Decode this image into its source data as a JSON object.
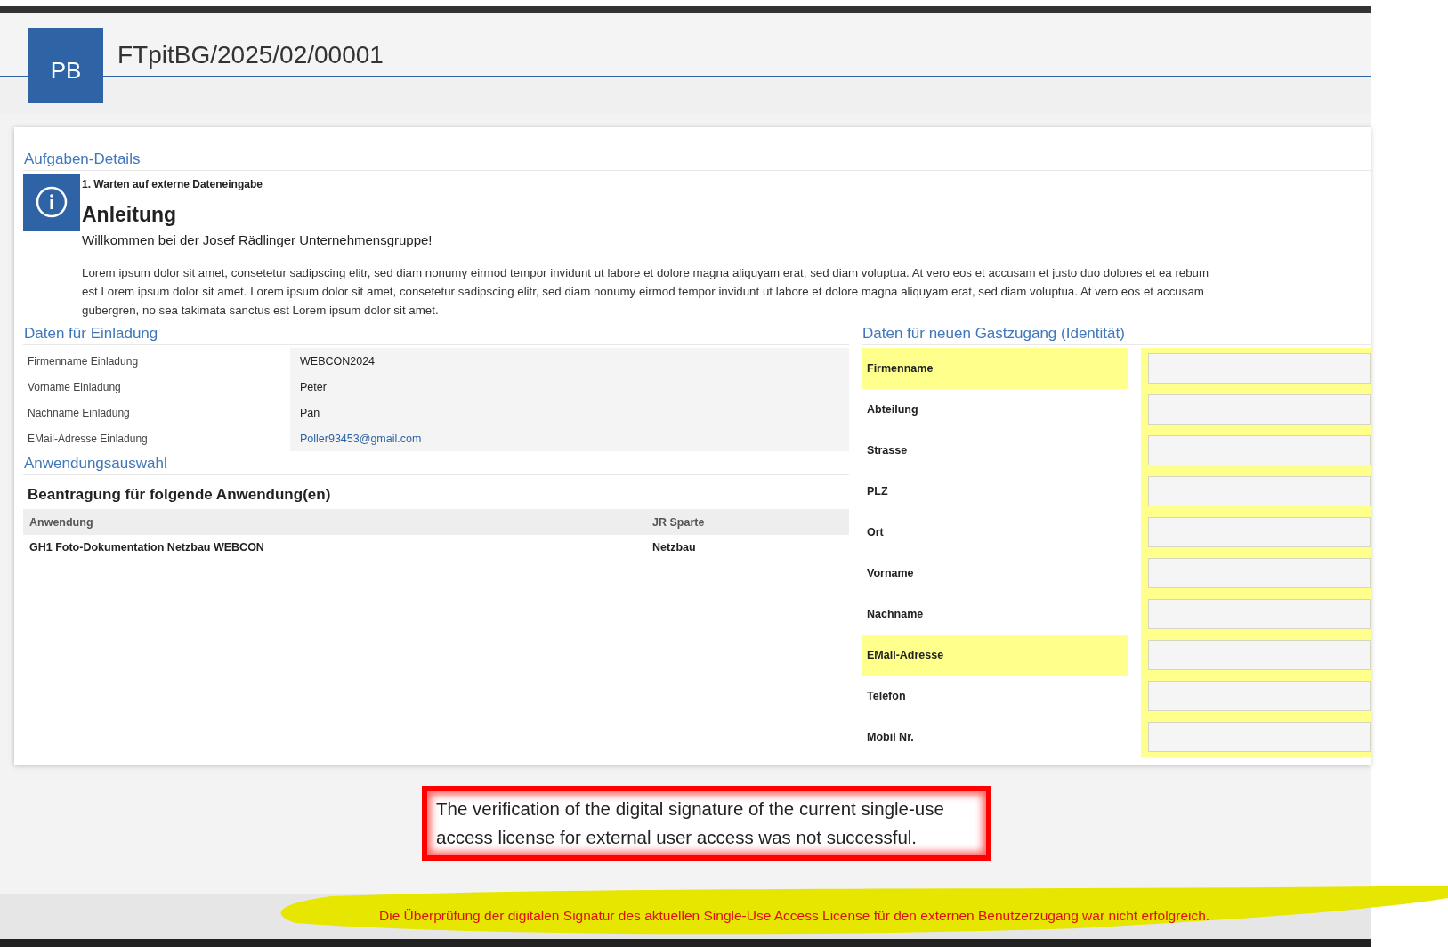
{
  "header": {
    "avatar": "PB",
    "title": "FTpitBG/2025/02/00001"
  },
  "task_details": {
    "heading": "Aufgaben-Details",
    "step": "1. Warten auf externe Dateneingabe",
    "instructions_title": "Anleitung",
    "welcome": "Willkommen bei der Josef Rädlinger Unternehmensgruppe!",
    "body_lines": [
      "Lorem ipsum dolor sit amet, consetetur sadipscing elitr, sed diam nonumy eirmod tempor invidunt ut labore et dolore magna aliquyam erat, sed diam voluptua. At vero eos et accusam et justo duo dolores et ea rebum",
      "est Lorem ipsum dolor sit amet. Lorem ipsum dolor sit amet, consetetur sadipscing elitr, sed diam nonumy eirmod tempor invidunt ut labore et dolore magna aliquyam erat, sed diam voluptua. At vero eos et accusam",
      "gubergren, no sea takimata sanctus est Lorem ipsum dolor sit amet."
    ]
  },
  "invitation": {
    "heading": "Daten für Einladung",
    "fields": [
      {
        "label": "Firmenname Einladung",
        "value": "WEBCON2024",
        "kind": "text"
      },
      {
        "label": "Vorname Einladung",
        "value": "Peter",
        "kind": "text"
      },
      {
        "label": "Nachname Einladung",
        "value": "Pan",
        "kind": "text"
      },
      {
        "label": "EMail-Adresse Einladung",
        "value": "Poller93453@gmail.com",
        "kind": "link"
      }
    ]
  },
  "application": {
    "heading": "Anwendungsauswahl",
    "title": "Beantragung für folgende Anwendung(en)",
    "columns": [
      "Anwendung",
      "JR Sparte"
    ],
    "rows": [
      [
        "GH1 Foto-Dokumentation Netzbau WEBCON",
        "Netzbau"
      ]
    ]
  },
  "guest_access": {
    "heading": "Daten für neuen Gastzugang (Identität)",
    "fields": [
      {
        "label": "Firmenname",
        "highlighted": true
      },
      {
        "label": "Abteilung",
        "highlighted": false
      },
      {
        "label": "Strasse",
        "highlighted": false
      },
      {
        "label": "PLZ",
        "highlighted": false
      },
      {
        "label": "Ort",
        "highlighted": false
      },
      {
        "label": "Vorname",
        "highlighted": false
      },
      {
        "label": "Nachname",
        "highlighted": false
      },
      {
        "label": "EMail-Adresse",
        "highlighted": true
      },
      {
        "label": "Telefon",
        "highlighted": false
      },
      {
        "label": "Mobil Nr.",
        "highlighted": false
      }
    ]
  },
  "error_popup": {
    "message": "The verification of the digital signature of the current single-use access license for external user access was not successful."
  },
  "status_bar": {
    "message": "Die Überprüfung der digitalen Signatur des aktuellen Single-Use Access License für den externen Benutzerzugang war nicht erfolgreich."
  }
}
